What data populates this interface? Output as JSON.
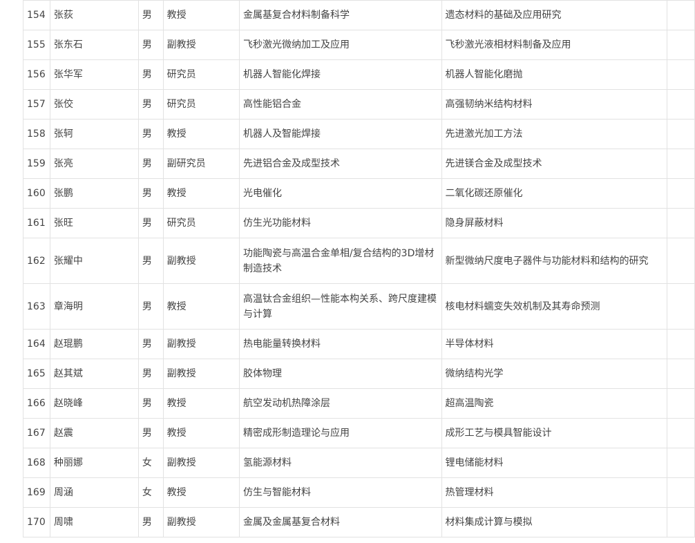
{
  "rows": [
    {
      "no": "154",
      "name": "张荻",
      "gender": "男",
      "title": "教授",
      "research": "金属基复合材料制备科学",
      "direction": "遗态材料的基础及应用研究"
    },
    {
      "no": "155",
      "name": "张东石",
      "gender": "男",
      "title": "副教授",
      "research": "飞秒激光微纳加工及应用",
      "direction": "飞秒激光液相材料制备及应用"
    },
    {
      "no": "156",
      "name": "张华军",
      "gender": "男",
      "title": "研究员",
      "research": "机器人智能化焊接",
      "direction": "机器人智能化磨抛"
    },
    {
      "no": "157",
      "name": "张佼",
      "gender": "男",
      "title": "研究员",
      "research": "高性能铝合金",
      "direction": "高强韧纳米结构材料"
    },
    {
      "no": "158",
      "name": "张轲",
      "gender": "男",
      "title": "教授",
      "research": "机器人及智能焊接",
      "direction": "先进激光加工方法"
    },
    {
      "no": "159",
      "name": "张亮",
      "gender": "男",
      "title": "副研究员",
      "research": "先进铝合金及成型技术",
      "direction": "先进镁合金及成型技术"
    },
    {
      "no": "160",
      "name": "张鹏",
      "gender": "男",
      "title": "教授",
      "research": "光电催化",
      "direction": "二氧化碳还原催化"
    },
    {
      "no": "161",
      "name": "张旺",
      "gender": "男",
      "title": "研究员",
      "research": "仿生光功能材料",
      "direction": "隐身屏蔽材料"
    },
    {
      "no": "162",
      "name": "张耀中",
      "gender": "男",
      "title": "副教授",
      "research": "功能陶瓷与高温合金单相/复合结构的3D增材制造技术",
      "direction": "新型微纳尺度电子器件与功能材料和结构的研究"
    },
    {
      "no": "163",
      "name": "章海明",
      "gender": "男",
      "title": "教授",
      "research": "高温钛合金组织—性能本构关系、跨尺度建模与计算",
      "direction": "核电材料蠕变失效机制及其寿命预测"
    },
    {
      "no": "164",
      "name": "赵琨鹏",
      "gender": "男",
      "title": "副教授",
      "research": "热电能量转换材料",
      "direction": "半导体材料"
    },
    {
      "no": "165",
      "name": "赵其斌",
      "gender": "男",
      "title": "副教授",
      "research": "胶体物理",
      "direction": "微纳结构光学"
    },
    {
      "no": "166",
      "name": "赵晓峰",
      "gender": "男",
      "title": "教授",
      "research": "航空发动机热障涂层",
      "direction": "超高温陶瓷"
    },
    {
      "no": "167",
      "name": "赵震",
      "gender": "男",
      "title": "教授",
      "research": "精密成形制造理论与应用",
      "direction": "成形工艺与模具智能设计"
    },
    {
      "no": "168",
      "name": "种丽娜",
      "gender": "女",
      "title": "副教授",
      "research": "氢能源材料",
      "direction": "锂电储能材料"
    },
    {
      "no": "169",
      "name": "周涵",
      "gender": "女",
      "title": "教授",
      "research": "仿生与智能材料",
      "direction": "热管理材料"
    },
    {
      "no": "170",
      "name": "周啸",
      "gender": "男",
      "title": "副教授",
      "research": "金属及金属基复合材料",
      "direction": "材料集成计算与模拟"
    }
  ]
}
